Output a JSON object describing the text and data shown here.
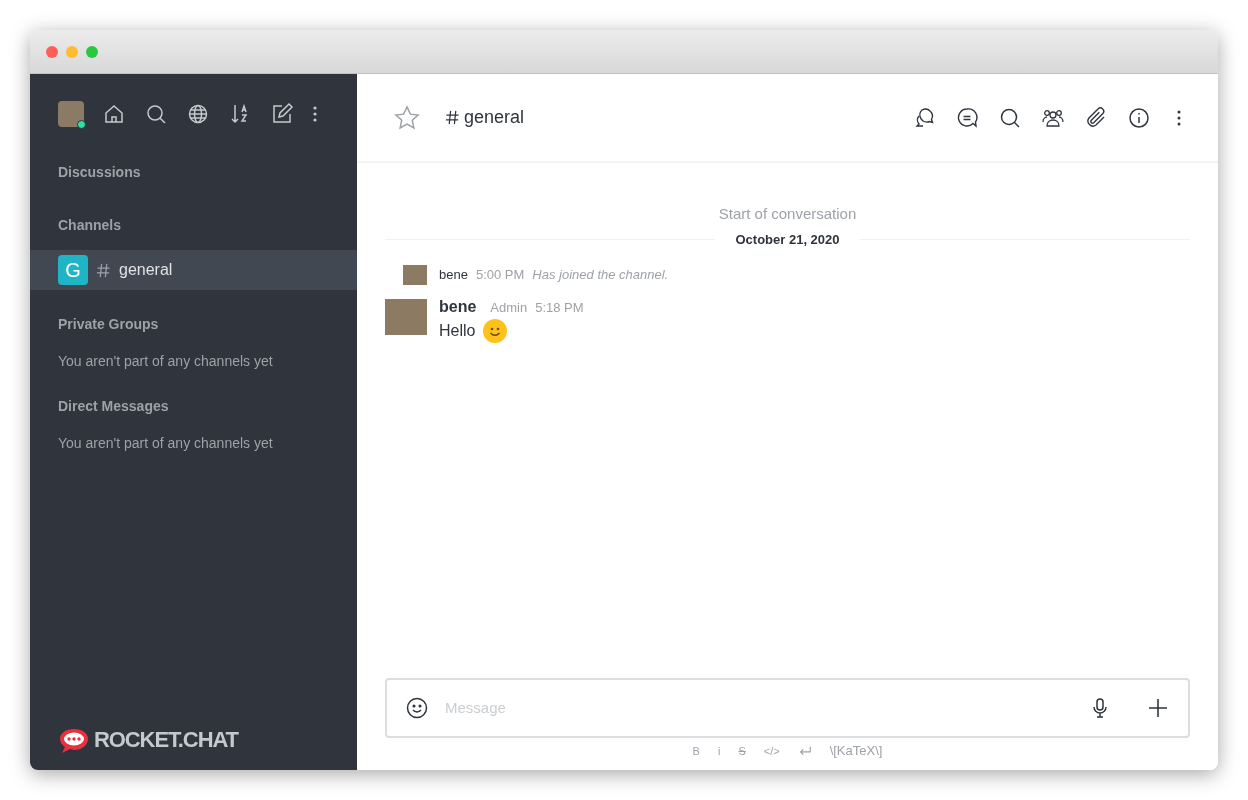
{
  "sidebar": {
    "sections": [
      {
        "title": "Discussions"
      },
      {
        "title": "Channels",
        "channels": [
          {
            "initial": "G",
            "name": "general",
            "color": "#1fb5c7",
            "selected": true
          }
        ]
      },
      {
        "title": "Private Groups",
        "empty_text": "You aren't part of any channels yet"
      },
      {
        "title": "Direct Messages",
        "empty_text": "You aren't part of any channels yet"
      }
    ],
    "user_status": {
      "color": "#2de0a5"
    },
    "logo": "ROCKET.CHAT"
  },
  "room": {
    "name": "general",
    "starred": false
  },
  "conversation": {
    "start_label": "Start of conversation",
    "date": "October 21, 2020",
    "messages": [
      {
        "kind": "system",
        "user": "bene",
        "time": "5:00 PM",
        "text": "Has joined the channel."
      },
      {
        "kind": "message",
        "user": "bene",
        "role": "Admin",
        "time": "5:18 PM",
        "text": "Hello"
      }
    ]
  },
  "composer": {
    "placeholder": "Message",
    "format": [
      {
        "kind": "bold",
        "label": "B"
      },
      {
        "kind": "italic",
        "label": "i"
      },
      {
        "kind": "strike",
        "label": "S"
      },
      {
        "kind": "code",
        "label": "</>"
      },
      {
        "kind": "newline"
      },
      {
        "kind": "katex",
        "label": "\\[KaTeX\\]"
      }
    ]
  }
}
